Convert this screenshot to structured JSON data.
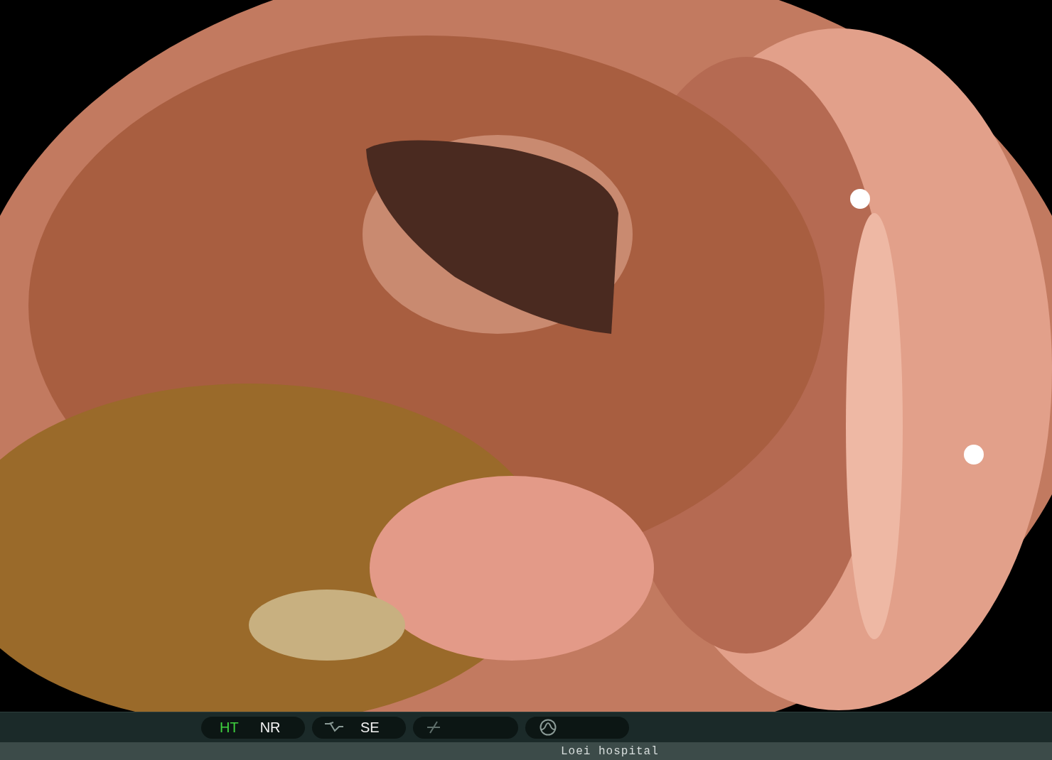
{
  "status_bar": {
    "pills": [
      {
        "kind": "modes",
        "items": [
          {
            "label": "HT",
            "on": true
          },
          {
            "label": "NR",
            "on": false
          }
        ]
      },
      {
        "kind": "curve",
        "items": [
          {
            "label": "SE",
            "on": false
          }
        ]
      },
      {
        "kind": "slash"
      },
      {
        "kind": "wave"
      }
    ],
    "caption": "Loei hospital"
  }
}
